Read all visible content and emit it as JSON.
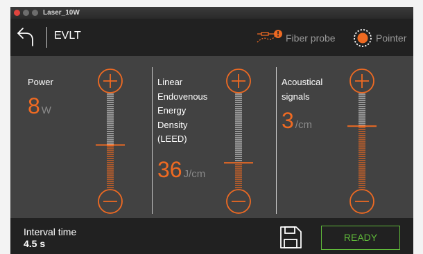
{
  "window": {
    "title": "Laser_10W"
  },
  "header": {
    "title": "EVLT",
    "fiber_probe_label": "Fiber probe",
    "pointer_label": "Pointer"
  },
  "params": [
    {
      "label_lines": [
        "Power"
      ],
      "value": "8",
      "unit": "W",
      "level": 0.46
    },
    {
      "label_lines": [
        "Linear",
        "Endovenous",
        "Energy",
        "Density",
        "(LEED)"
      ],
      "value": "36",
      "unit": "J/cm",
      "level": 0.27
    },
    {
      "label_lines": [
        "Acoustical",
        "signals"
      ],
      "value": "3",
      "unit": "/cm",
      "level": 0.66
    }
  ],
  "footer": {
    "interval_label": "Interval time",
    "interval_value": "4.5 s",
    "ready_label": "READY"
  },
  "colors": {
    "accent": "#ef6a22",
    "ready": "#5fb83a",
    "track": "#cfcfcf"
  }
}
